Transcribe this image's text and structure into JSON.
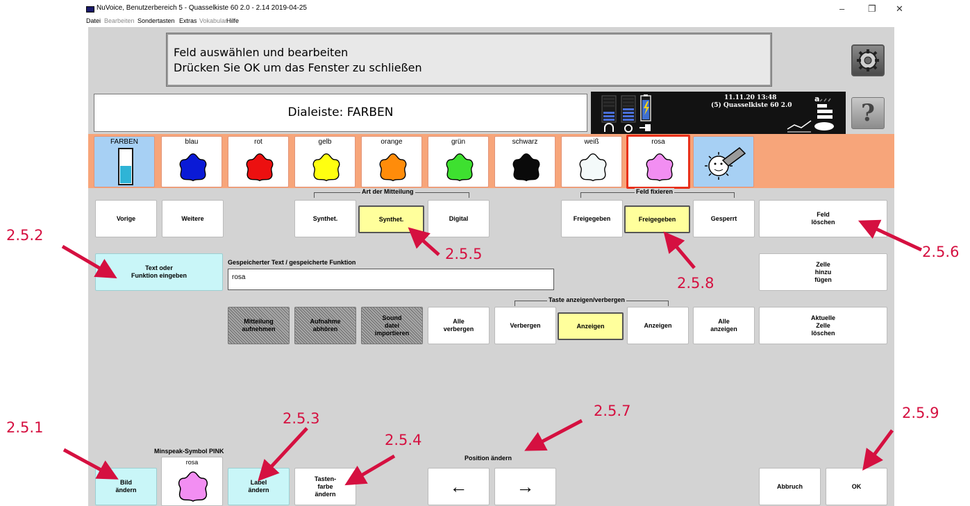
{
  "window": {
    "title": "NuVoice, Benutzerbereich 5 - Quasselkiste 60 2.0 - 2.14 2019-04-25",
    "minimize_glyph": "–",
    "restore_glyph": "❐",
    "close_glyph": "✕"
  },
  "menu": [
    {
      "label": "Datei",
      "enabled": true
    },
    {
      "label": "Bearbeiten",
      "enabled": false
    },
    {
      "label": "Sondertasten",
      "enabled": true
    },
    {
      "label": "Extras",
      "enabled": true
    },
    {
      "label": "Vokabular",
      "enabled": false
    },
    {
      "label": "Hilfe",
      "enabled": true
    }
  ],
  "message": {
    "line1": "Feld auswählen und bearbeiten",
    "line2": "Drücken Sie OK um das Fenster zu schließen"
  },
  "help_label": "?",
  "dialeiste": "Dialeiste: FARBEN",
  "status": {
    "datetime": "11.11.20 13:48",
    "device": "(5) Quasselkiste 60 2.0",
    "mode": "a"
  },
  "color_keys": [
    {
      "label": "FARBEN",
      "icon": "folder-icon"
    },
    {
      "label": "blau",
      "color": "#0a1ad6"
    },
    {
      "label": "rot",
      "color": "#ec1010"
    },
    {
      "label": "gelb",
      "color": "#ffff10"
    },
    {
      "label": "orange",
      "color": "#ff8c0a"
    },
    {
      "label": "grün",
      "color": "#3ee030"
    },
    {
      "label": "schwarz",
      "color": "#0a0a0a"
    },
    {
      "label": "weiß",
      "color": "#f4fafa"
    },
    {
      "label": "rosa",
      "color": "#f28ef2"
    },
    {
      "label": "",
      "icon": "eraser-icon"
    }
  ],
  "groups": {
    "art": "Art der Mitteilung",
    "fixieren": "Feld fixieren",
    "taste": "Taste anzeigen/verbergen"
  },
  "buttons": {
    "vorige": "Vorige",
    "weitere": "Weitere",
    "synthet1": "Synthet.",
    "synthet2": "Synthet.",
    "digital": "Digital",
    "freigegeben1": "Freigegeben",
    "freigegeben2": "Freigegeben",
    "gesperrt": "Gesperrt",
    "feld_loeschen": "Feld\nlöschen",
    "text_funktion": "Text oder\nFunktion eingeben",
    "zelle_hinzu": "Zelle\nhinzu\nfügen",
    "mitteilung_aufnehmen": "Mitteilung\naufnehmen",
    "aufnahme_abhoeren": "Aufnahme\nabhören",
    "sound_import": "Sound\ndatei\nimportieren",
    "alle_verbergen": "Alle\nverbergen",
    "verbergen": "Verbergen",
    "anzeigen1": "Anzeigen",
    "anzeigen2": "Anzeigen",
    "alle_anzeigen": "Alle\nanzeigen",
    "zelle_loeschen": "Aktuelle\nZelle\nlöschen",
    "bild_aendern": "Bild\nändern",
    "label_aendern": "Label\nändern",
    "tastenfarbe": "Tasten-\nfarbe\nändern",
    "left_arrow": "←",
    "right_arrow": "→",
    "abbruch": "Abbruch",
    "ok": "OK"
  },
  "stored_text_label": "Gespeicherter Text / gespeicherte Funktion",
  "stored_text_value": "rosa",
  "minspeak_label": "Minspeak-Symbol PINK",
  "minspeak_icon_label": "rosa",
  "label_count": "3",
  "position_label": "Position ändern",
  "annotations": {
    "a251": "2.5.1",
    "a252": "2.5.2",
    "a253": "2.5.3",
    "a254": "2.5.4",
    "a255": "2.5.5",
    "a256": "2.5.6",
    "a257": "2.5.7",
    "a258": "2.5.8",
    "a259": "2.5.9"
  },
  "colors": {
    "background": "#d3d3d3",
    "colorbar": "#f7a57a",
    "selected_toggle": "#ffff9c",
    "accent_cyan": "#c9f6f8",
    "annotation": "#d51040",
    "selected_border": "#e8301a"
  }
}
